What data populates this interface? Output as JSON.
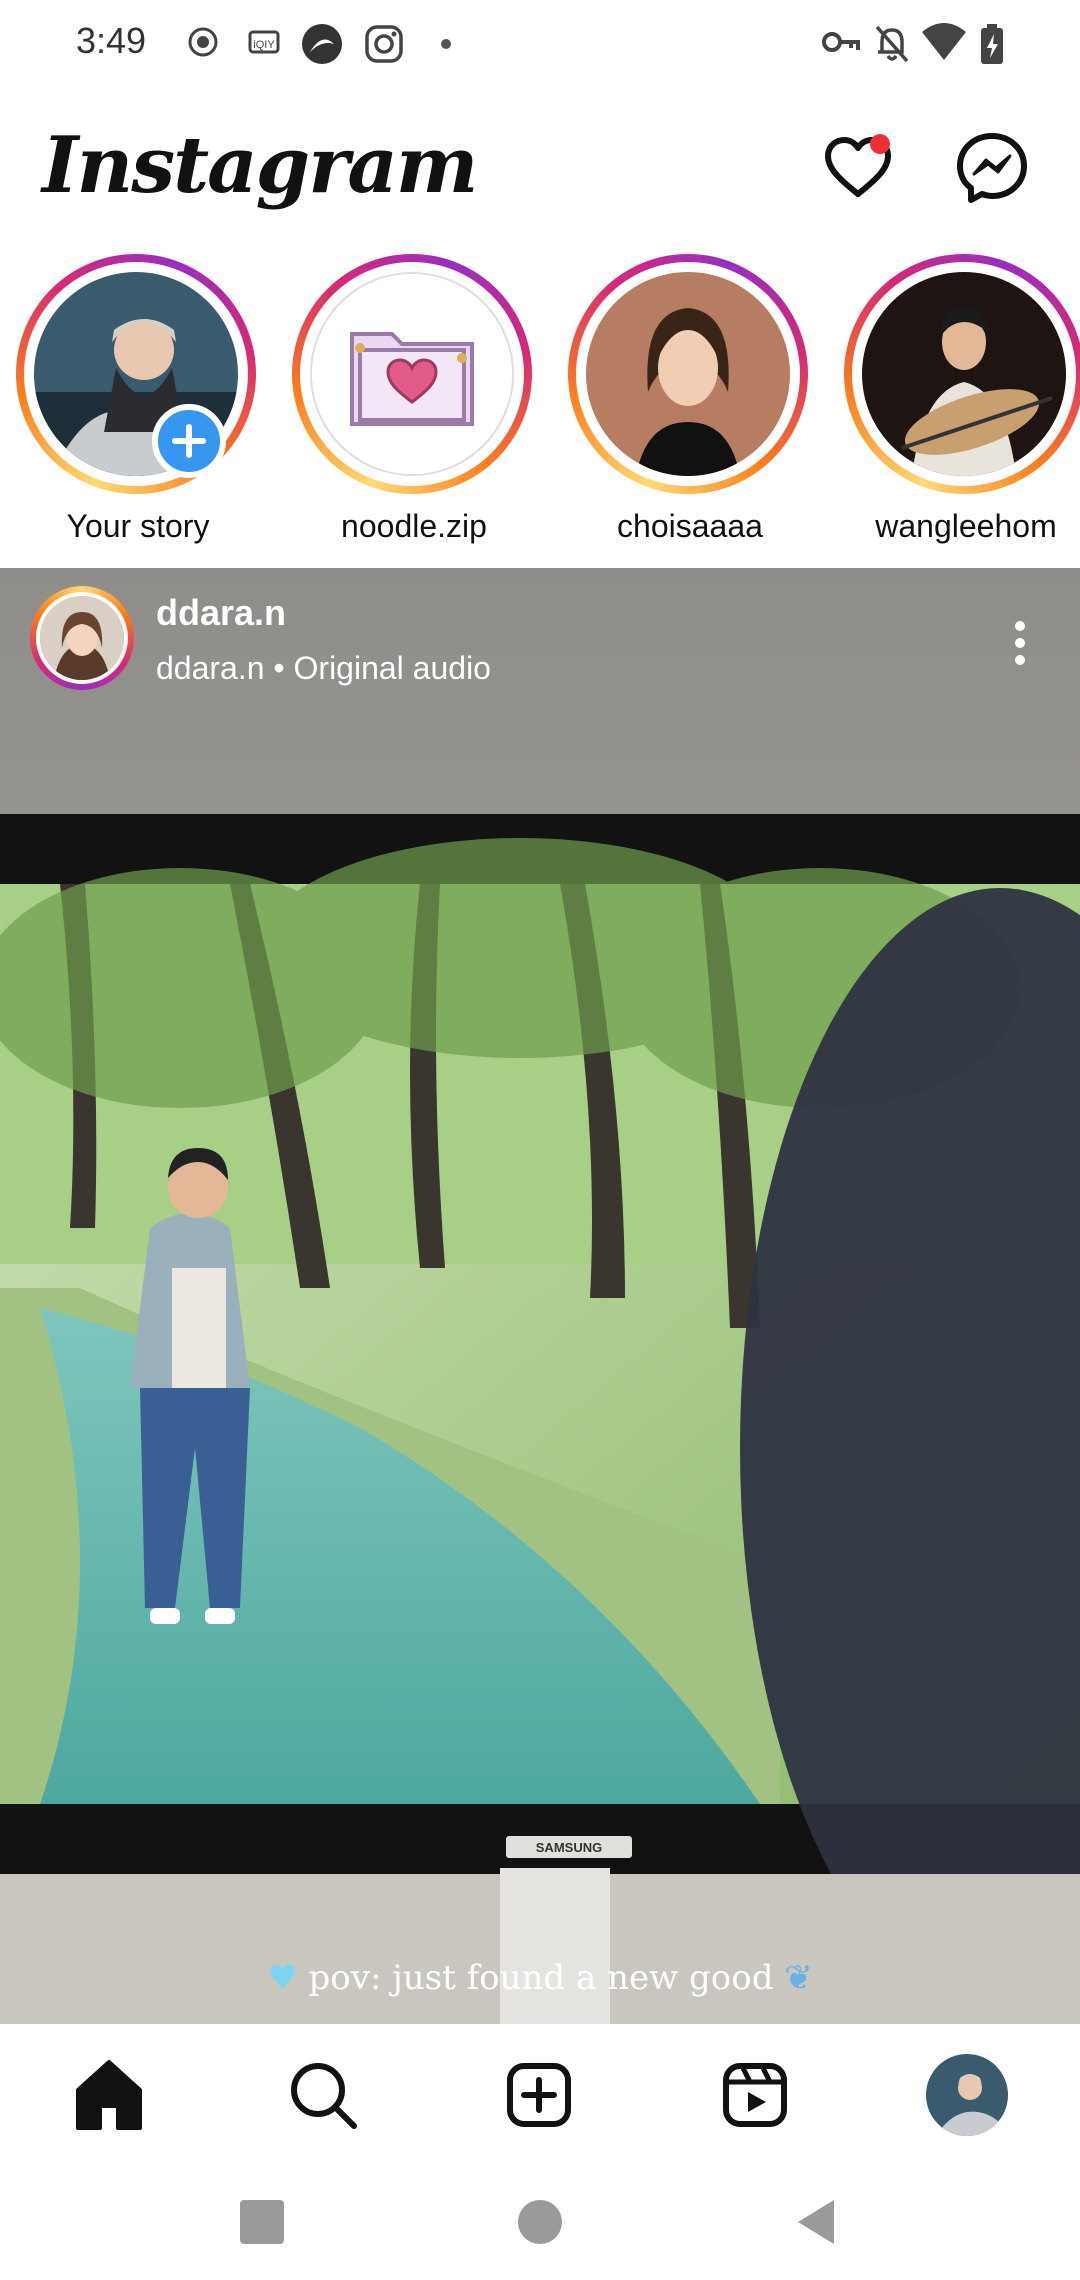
{
  "status_bar": {
    "time": "3:49",
    "left_icons": [
      "record-icon",
      "iqiyi-icon",
      "app-icon",
      "instagram-icon",
      "dot-icon"
    ],
    "right_icons": [
      "vpn-key-icon",
      "bell-off-icon",
      "wifi-icon",
      "battery-charging-icon"
    ]
  },
  "header": {
    "logo_text": "Instagram",
    "notifications_icon": "heart-icon",
    "notification_dot_color": "#ed2f3b",
    "messenger_icon": "messenger-icon"
  },
  "stories": [
    {
      "label": "Your story",
      "has_add_badge": true
    },
    {
      "label": "noodle.zip"
    },
    {
      "label": "choisaaaa"
    },
    {
      "label": "wangleehom"
    }
  ],
  "post": {
    "username": "ddara.n",
    "audio": "ddara.n • Original audio",
    "caption_line1": "pov: just found a new good",
    "monitor_brand": "SAMSUNG"
  },
  "bottom_nav": {
    "items": [
      "home-icon",
      "search-icon",
      "create-icon",
      "reels-icon",
      "profile-avatar"
    ]
  },
  "system_nav": [
    "recents-icon",
    "home-circle-icon",
    "back-icon"
  ],
  "colors": {
    "accent_blue": "#3797f0",
    "story_ring": [
      "#feda75",
      "#fa7e1e",
      "#d62976",
      "#962fbf"
    ]
  }
}
